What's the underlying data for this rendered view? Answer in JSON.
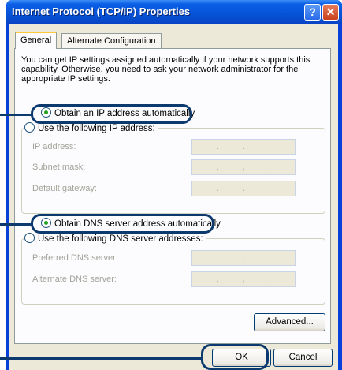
{
  "window": {
    "title": "Internet Protocol (TCP/IP) Properties",
    "help_glyph": "?",
    "close_glyph": "✕"
  },
  "tabs": [
    {
      "label": "General",
      "selected": true
    },
    {
      "label": "Alternate Configuration",
      "selected": false
    }
  ],
  "general": {
    "description": "You can get IP settings assigned automatically if your network supports this capability. Otherwise, you need to ask your network administrator for the appropriate IP settings.",
    "ip_auto_label": "Obtain an IP address automatically",
    "ip_manual_label": "Use the following IP address:",
    "ip_fields": [
      {
        "label": "IP address:"
      },
      {
        "label": "Subnet mask:"
      },
      {
        "label": "Default gateway:"
      }
    ],
    "dns_auto_label": "Obtain DNS server address automatically",
    "dns_manual_label": "Use the following DNS server addresses:",
    "dns_fields": [
      {
        "label": "Preferred DNS server:"
      },
      {
        "label": "Alternate DNS server:"
      }
    ],
    "advanced_label": "Advanced..."
  },
  "footer": {
    "ok_label": "OK",
    "cancel_label": "Cancel"
  },
  "ip_separator": ".",
  "colors": {
    "titlebar": "#0653d8",
    "dialog_bg": "#ece9d8",
    "callout": "#0d3a6e",
    "radio_selected": "#21a121"
  }
}
